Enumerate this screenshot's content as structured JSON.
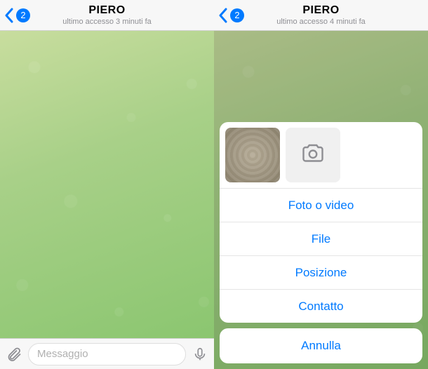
{
  "colors": {
    "accent": "#007aff",
    "secondary": "#8e8e93"
  },
  "left": {
    "header": {
      "title": "PIERO",
      "subtitle": "ultimo accesso 3 minuti fa",
      "badge": "2"
    },
    "input": {
      "placeholder": "Messaggio"
    }
  },
  "right": {
    "header": {
      "title": "PIERO",
      "subtitle": "ultimo accesso 4 minuti fa",
      "badge": "2"
    },
    "action_sheet": {
      "items": [
        "Foto o video",
        "File",
        "Posizione",
        "Contatto"
      ],
      "cancel": "Annulla"
    }
  }
}
